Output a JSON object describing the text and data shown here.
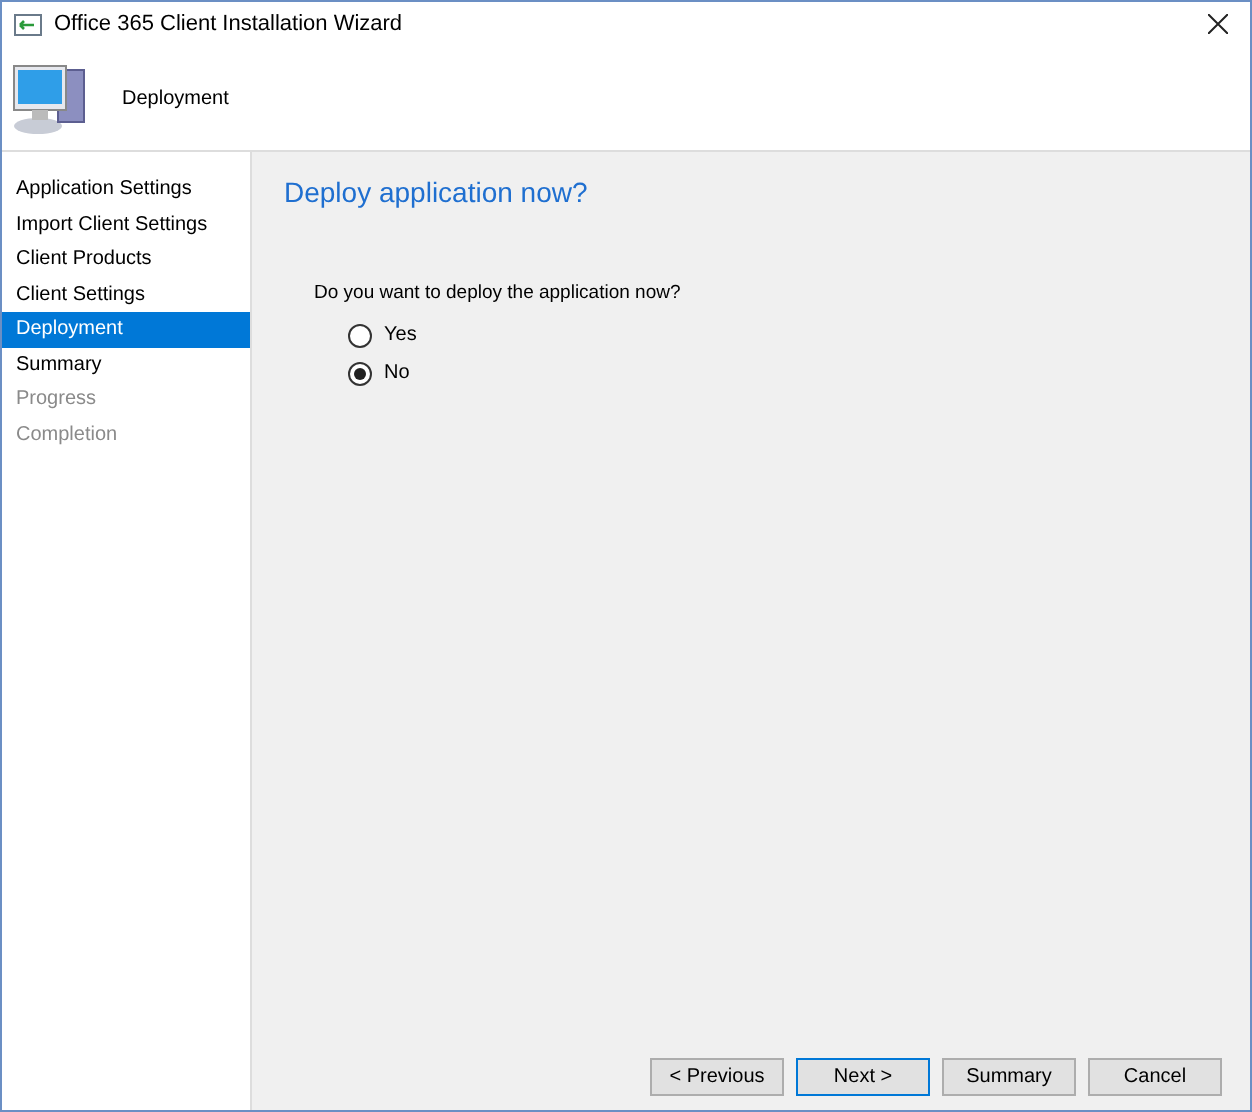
{
  "window": {
    "title": "Office 365 Client Installation Wizard"
  },
  "header": {
    "title": "Deployment"
  },
  "steps": [
    {
      "label": "Application Settings",
      "selected": false,
      "disabled": false
    },
    {
      "label": "Import Client Settings",
      "selected": false,
      "disabled": false
    },
    {
      "label": "Client Products",
      "selected": false,
      "disabled": false
    },
    {
      "label": "Client Settings",
      "selected": false,
      "disabled": false
    },
    {
      "label": "Deployment",
      "selected": true,
      "disabled": false
    },
    {
      "label": "Summary",
      "selected": false,
      "disabled": false
    },
    {
      "label": "Progress",
      "selected": false,
      "disabled": true
    },
    {
      "label": "Completion",
      "selected": false,
      "disabled": true
    }
  ],
  "page": {
    "heading": "Deploy application now?",
    "question": "Do you want to deploy the application now?",
    "options": [
      {
        "label": "Yes",
        "selected": false
      },
      {
        "label": "No",
        "selected": true
      }
    ]
  },
  "buttons": [
    {
      "label": "< Previous",
      "default": false
    },
    {
      "label": "Next >",
      "default": true
    },
    {
      "label": "Summary",
      "default": false
    },
    {
      "label": "Cancel",
      "default": false
    }
  ]
}
